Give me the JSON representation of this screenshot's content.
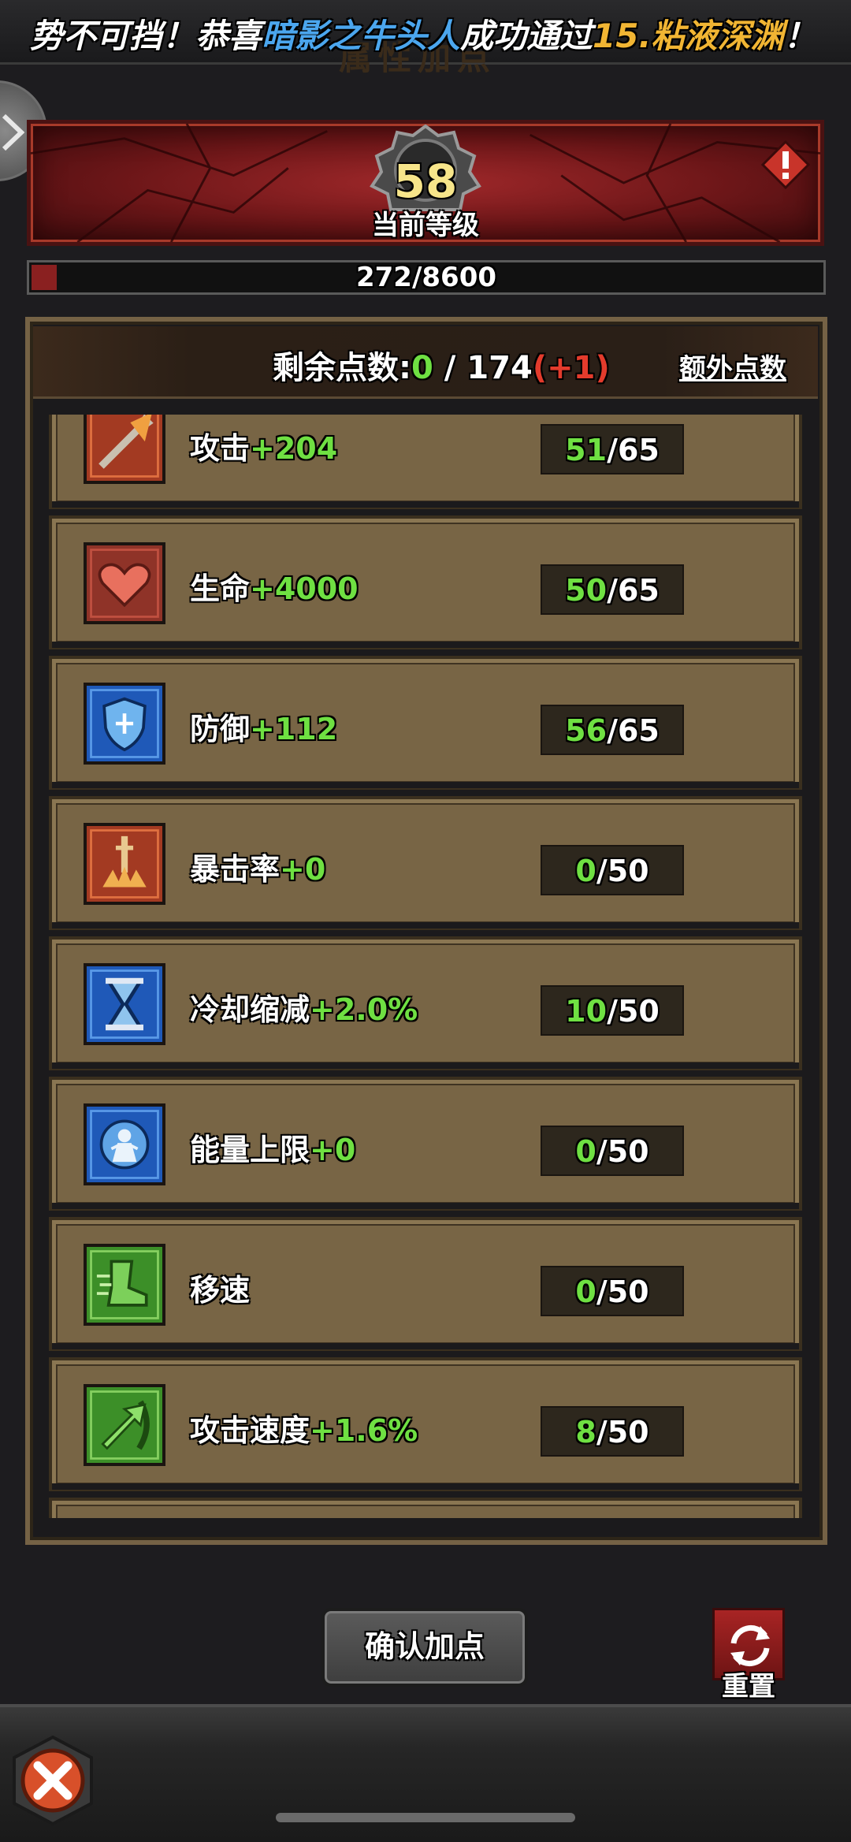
{
  "banner": {
    "title": "属性加点",
    "msg_prefix": "势不可挡！恭喜",
    "player": "暗影之牛头人",
    "msg_mid": "成功通过",
    "stage": "15.粘液深渊",
    "msg_suffix": "！"
  },
  "level": {
    "value": "58",
    "label": "当前等级"
  },
  "xp": {
    "text": "272/8600",
    "fraction": 0.0316
  },
  "points": {
    "label": "剩余点数:",
    "remaining": "0",
    "separator": " / ",
    "total": "174",
    "bonus": "(+1)",
    "extra_label": "额外点数"
  },
  "stats": [
    {
      "name": "攻击",
      "bonus": "+204",
      "current": "51",
      "max": "/65",
      "icon": "sword-icon",
      "color": "#a33a22"
    },
    {
      "name": "生命",
      "bonus": "+4000",
      "current": "50",
      "max": "/65",
      "icon": "heart-icon",
      "color": "#8f3328"
    },
    {
      "name": "防御",
      "bonus": "+112",
      "current": "56",
      "max": "/65",
      "icon": "shield-icon",
      "color": "#1f59b8"
    },
    {
      "name": "暴击率",
      "bonus": "+0",
      "current": "0",
      "max": "/50",
      "icon": "crit-sword-icon",
      "color": "#a33a22"
    },
    {
      "name": "冷却缩减",
      "bonus": "+2.0%",
      "current": "10",
      "max": "/50",
      "icon": "hourglass-icon",
      "color": "#1f59b8"
    },
    {
      "name": "能量上限",
      "bonus": "+0",
      "current": "0",
      "max": "/50",
      "icon": "energy-figure-icon",
      "color": "#1f59b8"
    },
    {
      "name": "移速",
      "bonus": "",
      "current": "0",
      "max": "/50",
      "icon": "boot-icon",
      "color": "#3c8f28"
    },
    {
      "name": "攻击速度",
      "bonus": "+1.6%",
      "current": "8",
      "max": "/50",
      "icon": "speed-arrow-icon",
      "color": "#3c8f28"
    }
  ],
  "buttons": {
    "confirm": "确认加点",
    "reset": "重置"
  }
}
